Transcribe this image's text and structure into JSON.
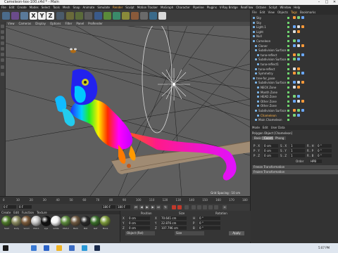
{
  "window": {
    "title": "Cameleon-tex-100.c4d * - Main",
    "controls": [
      "–",
      "□",
      "✕"
    ]
  },
  "menubar": {
    "items": [
      "File",
      "Edit",
      "Create",
      "Modes",
      "Select",
      "Tools",
      "Mesh",
      "Snap",
      "Animate",
      "Simulate",
      "Render",
      "Sculpt",
      "Motion Tracker",
      "MoGraph",
      "Character",
      "Pipeline",
      "Plugins",
      "V-Ray Bridge",
      "RealFlow",
      "Octane",
      "Script",
      "Window",
      "Help"
    ],
    "highlight_index": 10
  },
  "toolbar": {
    "axis_buttons": [
      "X",
      "Y",
      "Z"
    ]
  },
  "viewport": {
    "menu": [
      "View",
      "Cameras",
      "Display",
      "Options",
      "Filter",
      "Panel",
      "ProRender"
    ],
    "grid_spacing": "Grid Spacing : 10 cm",
    "colors": {
      "background": "#5f5f5f",
      "grid": "#1e1e1e"
    }
  },
  "object_manager": {
    "tabs": [
      "File",
      "Edit",
      "View",
      "Objects",
      "Tags",
      "Bookmarks"
    ],
    "active_tab": 4,
    "rows": [
      {
        "label": "Sky",
        "indent": 0
      },
      {
        "label": "Sky",
        "indent": 0
      },
      {
        "label": "Light.1",
        "indent": 0
      },
      {
        "label": "Light",
        "indent": 0
      },
      {
        "label": "Null",
        "indent": 0
      },
      {
        "label": "Cameleon",
        "indent": 0
      },
      {
        "label": "Cloner",
        "indent": 1
      },
      {
        "label": "Subdivision Surface",
        "indent": 1
      },
      {
        "label": "tuna-reflect",
        "indent": 2
      },
      {
        "label": "Subdivision Surface",
        "indent": 1
      },
      {
        "label": "tuna-reflect1",
        "indent": 2
      },
      {
        "label": "tuna-reflect",
        "indent": 1
      },
      {
        "label": "Symmetry",
        "indent": 1
      },
      {
        "label": "tree-for_pose",
        "indent": 0
      },
      {
        "label": "Subdivision Surface",
        "indent": 1
      },
      {
        "label": "NECK Zone",
        "indent": 2
      },
      {
        "label": "Month Zone",
        "indent": 2
      },
      {
        "label": "HEAD Zone",
        "indent": 2
      },
      {
        "label": "Other Zone",
        "indent": 2
      },
      {
        "label": "Other Zone",
        "indent": 2
      },
      {
        "label": "Subdivision Surface",
        "indent": 1
      },
      {
        "label": "Chameleon",
        "indent": 2
      },
      {
        "label": "Main Chameleon",
        "indent": 1
      }
    ],
    "selected_index": 21
  },
  "attribute_manager": {
    "menu": [
      "Mode",
      "Edit",
      "User Data"
    ],
    "title": "Polygon Object [Chameleon]",
    "tabs": [
      "Basic",
      "Coord.",
      "Phong"
    ],
    "active_tab": 1,
    "coords": [
      {
        "label": "P . X",
        "value": "0 cm",
        "label2": "S . X",
        "value2": "1",
        "label3": "R . H",
        "value3": "0 °"
      },
      {
        "label": "P . Y",
        "value": "0 cm",
        "label2": "S . Y",
        "value2": "1",
        "label3": "R . P",
        "value3": "0 °"
      },
      {
        "label": "P . Z",
        "value": "0 cm",
        "label2": "S . Z",
        "value2": "1",
        "label3": "R . B",
        "value3": "0 °"
      }
    ],
    "order_label": "Order",
    "order_value": "HPB",
    "sections": [
      "Freeze Transformation",
      "Frozen Transformation"
    ]
  },
  "timeline": {
    "ticks": [
      "0",
      "10",
      "20",
      "30",
      "40",
      "50",
      "60",
      "70",
      "80",
      "90",
      "100",
      "110",
      "120",
      "130",
      "140",
      "150",
      "160",
      "170",
      "180"
    ],
    "current_frame": "0 F",
    "start_frame": "0 F",
    "end_frame": "180 F",
    "end_frame2": "180 F"
  },
  "material_manager": {
    "menu": [
      "Create",
      "Edit",
      "Function",
      "Texture"
    ],
    "materials": [
      {
        "name": "head",
        "color": "#4f7a2a"
      },
      {
        "name": "body",
        "color": "#8a8a60"
      },
      {
        "name": "wood",
        "color": "#7a5a3a"
      },
      {
        "name": "Mat.1",
        "color": "#c8c8c8"
      },
      {
        "name": "eye",
        "color": "#111111"
      },
      {
        "name": "white",
        "color": "#f4f4f4"
      },
      {
        "name": "Mat.2",
        "color": "#5c8a3c"
      },
      {
        "name": "Bark",
        "color": "#6e5840"
      },
      {
        "name": "Mat",
        "color": "#2a2a2a"
      },
      {
        "name": "leaf",
        "color": "#3a6e2a"
      },
      {
        "name": "Moss",
        "color": "#7d9a3b"
      },
      {
        "name": "Mat.3",
        "color": "#9a9a9a"
      }
    ]
  },
  "coordinates": {
    "headers": [
      "Position",
      "Size",
      "Rotation"
    ],
    "rows": [
      {
        "axis": "X",
        "pos": "0 cm",
        "size": "70.641 cm",
        "rot_axis": "H",
        "rot": "0 °"
      },
      {
        "axis": "Y",
        "pos": "0 cm",
        "size": "22.876 cm",
        "rot_axis": "P",
        "rot": "0 °"
      },
      {
        "axis": "Z",
        "pos": "0 cm",
        "size": "107.796 cm",
        "rot_axis": "B",
        "rot": "0 °"
      }
    ],
    "mode": "Object (Rel)",
    "size_mode": "Size",
    "apply_label": "Apply"
  },
  "taskbar": {
    "time": "5:07 PM"
  }
}
